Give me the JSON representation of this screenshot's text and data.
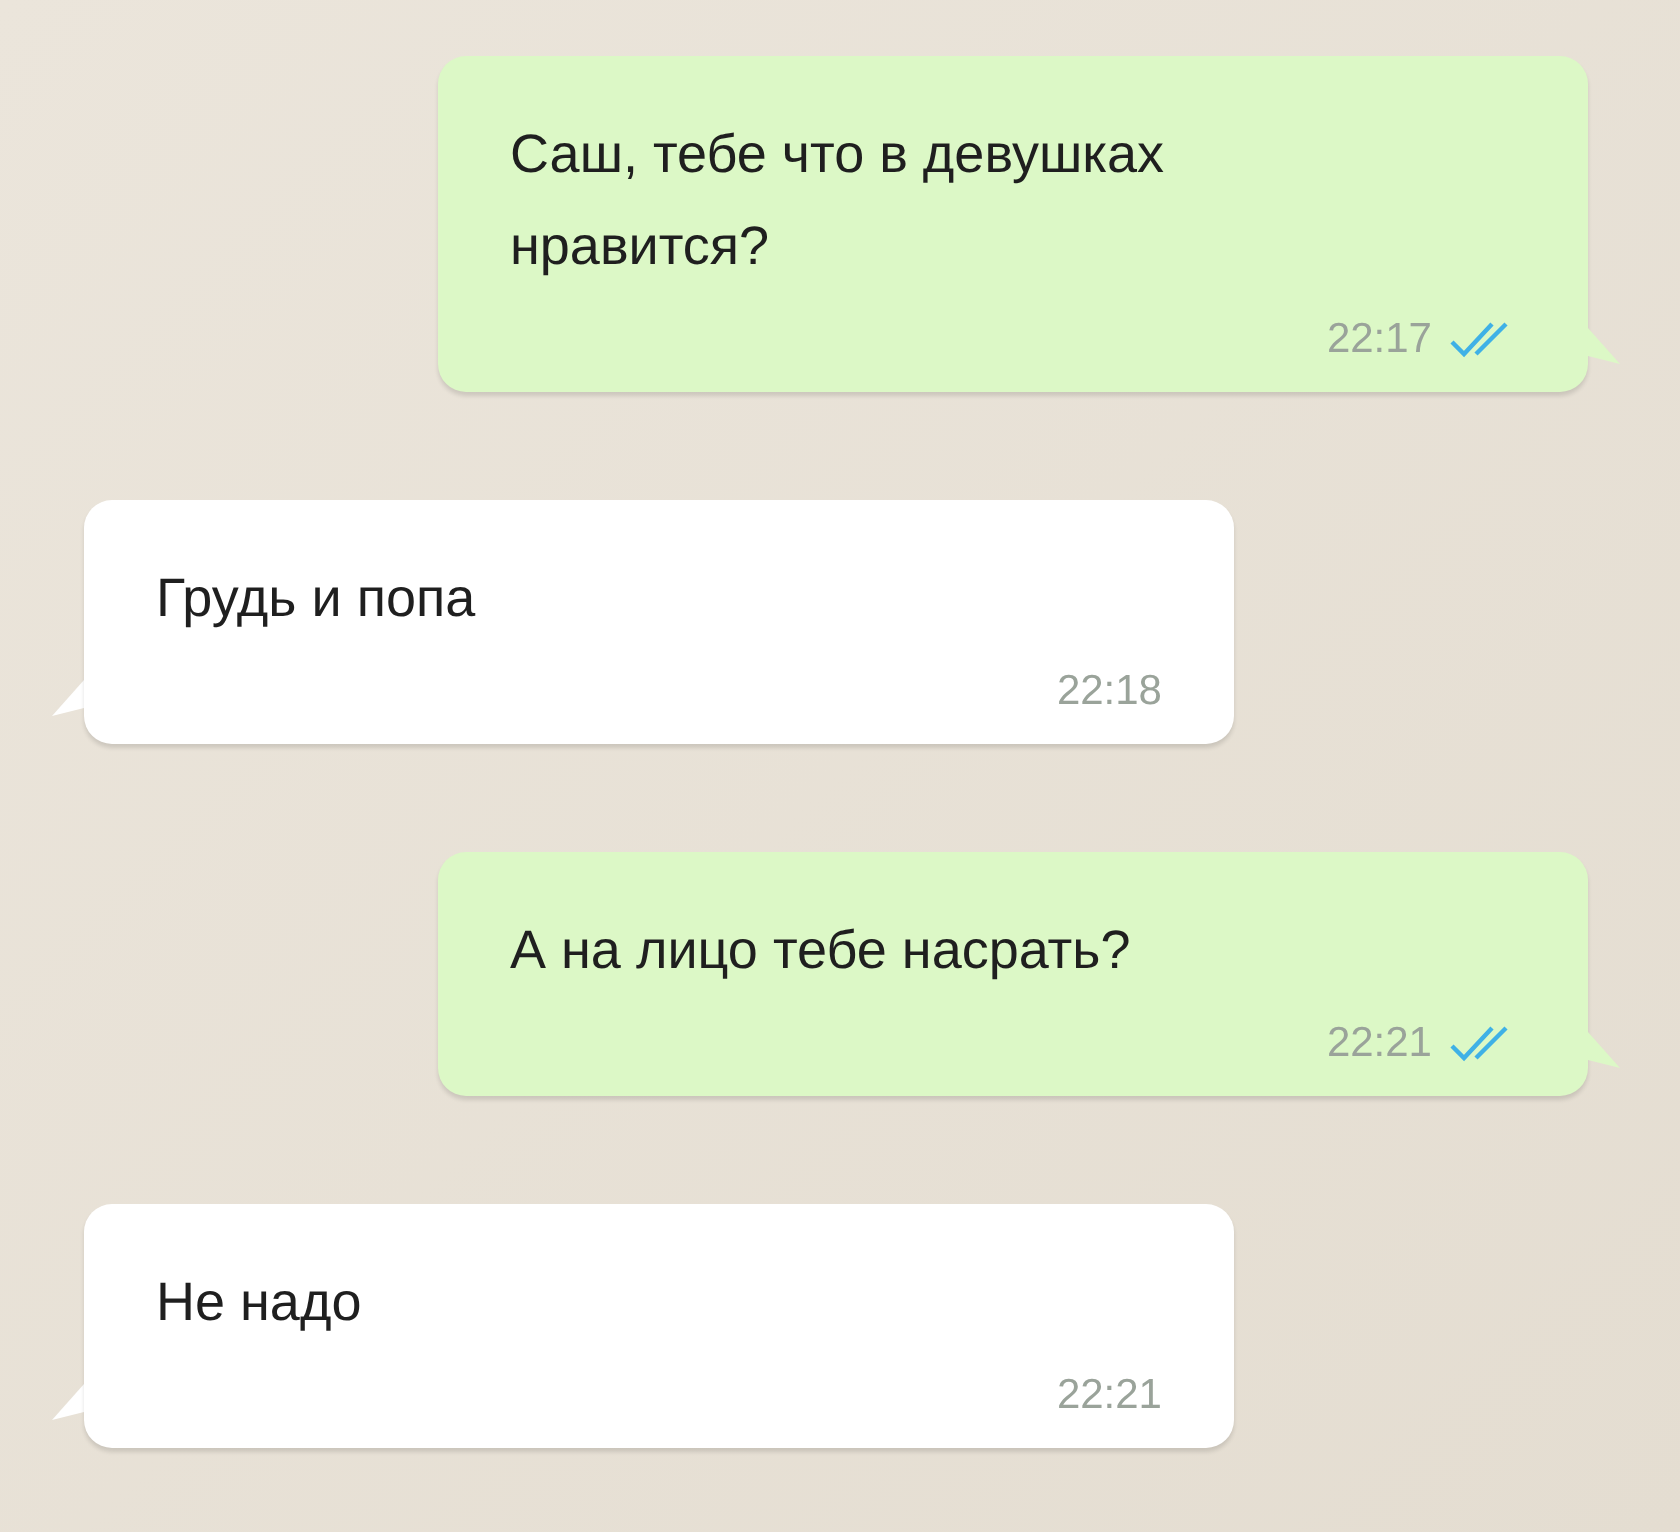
{
  "messages": [
    {
      "kind": "outgoing",
      "text": "Саш, тебе что в девушках нравится?",
      "time": "22:17",
      "read": true
    },
    {
      "kind": "incoming",
      "text": "Грудь и попа",
      "time": "22:18"
    },
    {
      "kind": "outgoing",
      "text": "А на лицо тебе насрать?",
      "time": "22:21",
      "read": true
    },
    {
      "kind": "incoming",
      "text": "Не надо",
      "time": "22:21"
    }
  ]
}
